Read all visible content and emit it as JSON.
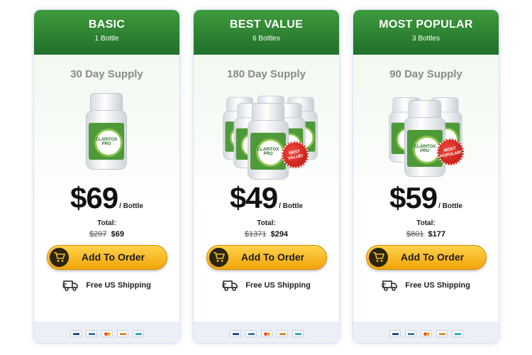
{
  "plans": [
    {
      "tier": "BASIC",
      "bottles": "1 Bottle",
      "supply": "30 Day Supply",
      "price": "$69",
      "per": "/ Bottle",
      "total_label": "Total:",
      "old_total": "$297",
      "new_total": "$69",
      "cta": "Add To Order",
      "shipping": "Free US Shipping"
    },
    {
      "tier": "BEST VALUE",
      "bottles": "6 Bottles",
      "supply": "180 Day Supply",
      "price": "$49",
      "per": "/ Bottle",
      "total_label": "Total:",
      "old_total": "$1371",
      "new_total": "$294",
      "badge_line1": "BEST",
      "badge_line2": "VALUE!",
      "cta": "Add To Order",
      "shipping": "Free US Shipping"
    },
    {
      "tier": "MOST POPULAR",
      "bottles": "3 Bottles",
      "supply": "90 Day Supply",
      "price": "$59",
      "per": "/ Bottle",
      "total_label": "Total:",
      "old_total": "$801",
      "new_total": "$177",
      "badge_line1": "MOST",
      "badge_line2": "POPULAR!",
      "cta": "Add To Order",
      "shipping": "Free US Shipping"
    }
  ],
  "product": {
    "brand": "CLARITOX PRO"
  },
  "payment_methods": [
    "visa-icon",
    "paypal-icon",
    "mastercard-icon",
    "discover-icon",
    "amex-icon"
  ],
  "colors": {
    "header_green": "#2f8a35",
    "cta_yellow": "#f5b51a",
    "badge_red": "#d32a22"
  }
}
